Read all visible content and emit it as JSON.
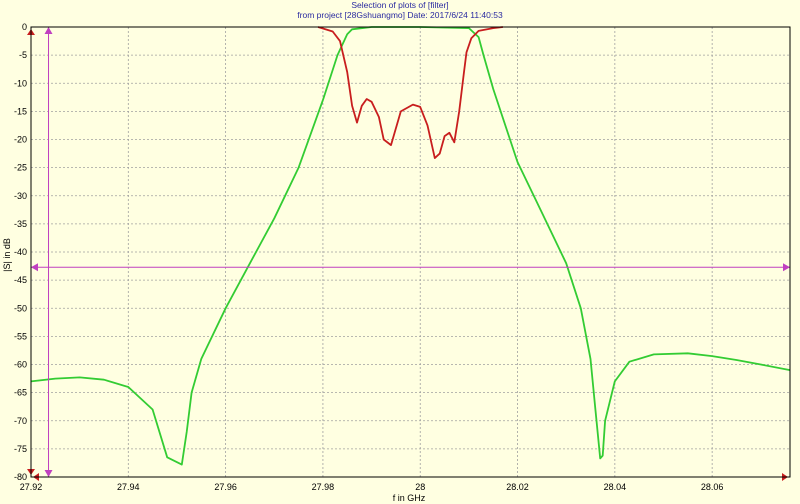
{
  "header": {
    "title": "Selection of plots of [filter]",
    "subtitle": "from project [28Gshuangmo]     Date: 2017/6/24 11:40:53"
  },
  "colors": {
    "background": "#ffffe1",
    "grid": "#a0a0a0",
    "s11": "#c81e1e",
    "s21": "#33cc33",
    "marker": "#c040c0",
    "title": "#2a2aa0"
  },
  "chart_data": {
    "type": "line",
    "xlabel": "f in GHz",
    "ylabel": "|S| in dB",
    "xlim": [
      27.92,
      28.076
    ],
    "ylim": [
      -80,
      0
    ],
    "xticks": [
      27.92,
      27.94,
      27.96,
      27.98,
      28,
      28.02,
      28.04,
      28.06
    ],
    "xtick_labels": [
      "27.92",
      "27.94",
      "27.96",
      "27.98",
      "28",
      "28.02",
      "28.04",
      "28.06"
    ],
    "yticks": [
      0,
      -5,
      -10,
      -15,
      -20,
      -25,
      -30,
      -35,
      -40,
      -45,
      -50,
      -55,
      -60,
      -65,
      -70,
      -75,
      -80
    ],
    "ytick_labels": [
      "0",
      "-5",
      "-10",
      "-15",
      "-20",
      "-25",
      "-30",
      "-35",
      "-40",
      "-45",
      "-50",
      "-55",
      "-60",
      "-65",
      "-70",
      "-75",
      "-80"
    ],
    "grid": true,
    "markers": {
      "x": 27.9236,
      "y": -42.7
    },
    "series": [
      {
        "color": "#33cc33",
        "x": [
          27.92,
          27.925,
          27.93,
          27.935,
          27.94,
          27.945,
          27.948,
          27.951,
          27.952,
          27.953,
          27.955,
          27.96,
          27.965,
          27.97,
          27.975,
          27.98,
          27.983,
          27.985,
          27.986,
          27.99,
          28.0,
          28.01,
          28.012,
          28.013,
          28.015,
          28.02,
          28.025,
          28.03,
          28.033,
          28.035,
          28.036,
          28.037,
          28.0375,
          28.038,
          28.04,
          28.043,
          28.048,
          28.055,
          28.06,
          28.065,
          28.07,
          28.076
        ],
        "y": [
          -63,
          -62.5,
          -62.3,
          -62.7,
          -64,
          -68,
          -76.5,
          -77.8,
          -72,
          -65,
          -59,
          -50,
          -42,
          -34,
          -25,
          -13,
          -5,
          -1.3,
          -0.4,
          0,
          0,
          -0.2,
          -1.8,
          -5,
          -11,
          -24,
          -33,
          -42,
          -50,
          -59,
          -68,
          -76.7,
          -76.2,
          -70,
          -63,
          -59.5,
          -58.2,
          -58,
          -58.5,
          -59.2,
          -60,
          -61
        ]
      },
      {
        "color": "#c81e1e",
        "x": [
          27.979,
          27.982,
          27.9835,
          27.985,
          27.986,
          27.987,
          27.988,
          27.989,
          27.99,
          27.9915,
          27.9925,
          27.994,
          27.995,
          27.996,
          27.9985,
          28.0,
          28.0015,
          28.003,
          28.004,
          28.005,
          28.006,
          28.007,
          28.008,
          28.009,
          28.0095,
          28.0105,
          28.012,
          28.015,
          28.017
        ],
        "y": [
          0,
          -0.8,
          -2.5,
          -8,
          -14,
          -17,
          -14,
          -12.8,
          -13.3,
          -16,
          -20,
          -21,
          -18,
          -15,
          -13.8,
          -14.2,
          -17.5,
          -23.3,
          -22.5,
          -19.4,
          -18.8,
          -20.5,
          -15,
          -8,
          -4.5,
          -2,
          -0.7,
          -0.2,
          0
        ]
      }
    ]
  }
}
